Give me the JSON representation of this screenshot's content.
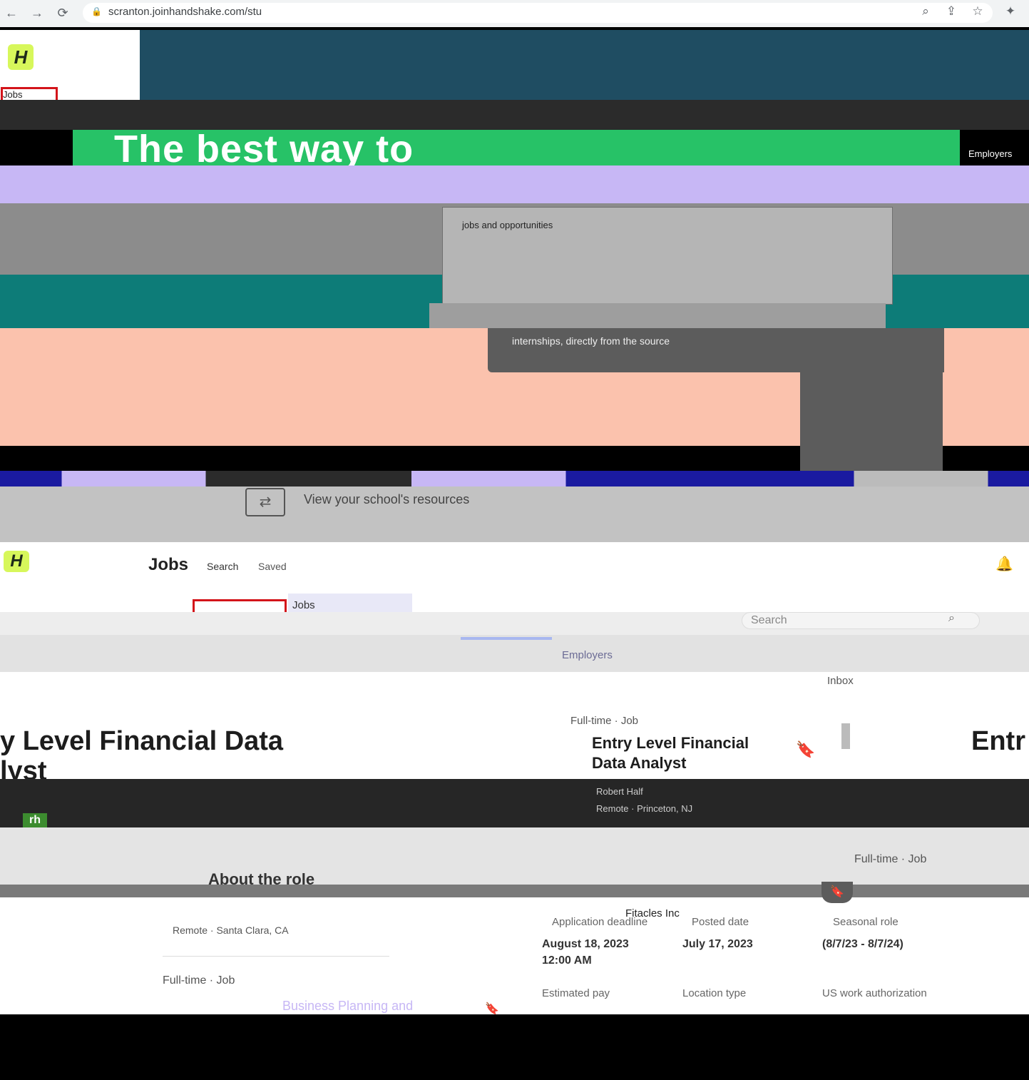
{
  "browser": {
    "back_icon": "arrow-left-icon",
    "forward_icon": "arrow-right-icon",
    "reload_icon": "reload-icon",
    "url": "scranton.joinhandshake.com/stu",
    "toolbar_icons": [
      "zoom-icon",
      "share-icon",
      "star-icon",
      "extension-icon"
    ]
  },
  "top": {
    "logo": "H",
    "jobs_tab": "Jobs",
    "headline": "The best way to",
    "employers_link": "Employers",
    "card_text": "jobs and opportunities",
    "intercept_text": "internships, directly from the source",
    "resources_text": "View your school's resources"
  },
  "bottom": {
    "logo": "H",
    "nav": {
      "title": "Jobs",
      "search": "Search",
      "saved": "Saved"
    },
    "dropdown_label": "Jobs",
    "search_placeholder": "Search",
    "employers": "Employers",
    "inbox": "Inbox",
    "job_type_1": "Full-time · Job",
    "job_type_2": "Full-time · Job",
    "job_type_3": "Full-time · Job",
    "big_title_line1": "y Level Financial Data",
    "big_title_line2": "lyst",
    "card_title": "Entry Level Financial Data Analyst",
    "right_title": "Entr",
    "company_logo": "rh",
    "company": "Robert Half",
    "location": "Remote · Princeton, NJ",
    "about_role": "About the role",
    "company_2": "Fitacles Inc",
    "remote_2": "Remote · Santa Clara, CA",
    "biz_text": "Business Planning and",
    "details": {
      "labels": [
        "Application deadline",
        "Posted date",
        "Seasonal role"
      ],
      "values": [
        "August 18, 2023\n12:00 AM",
        "July 17, 2023",
        "(8/7/23 - 8/7/24)"
      ],
      "labels_2": [
        "Estimated pay",
        "Location type",
        "US work authorization"
      ]
    }
  }
}
